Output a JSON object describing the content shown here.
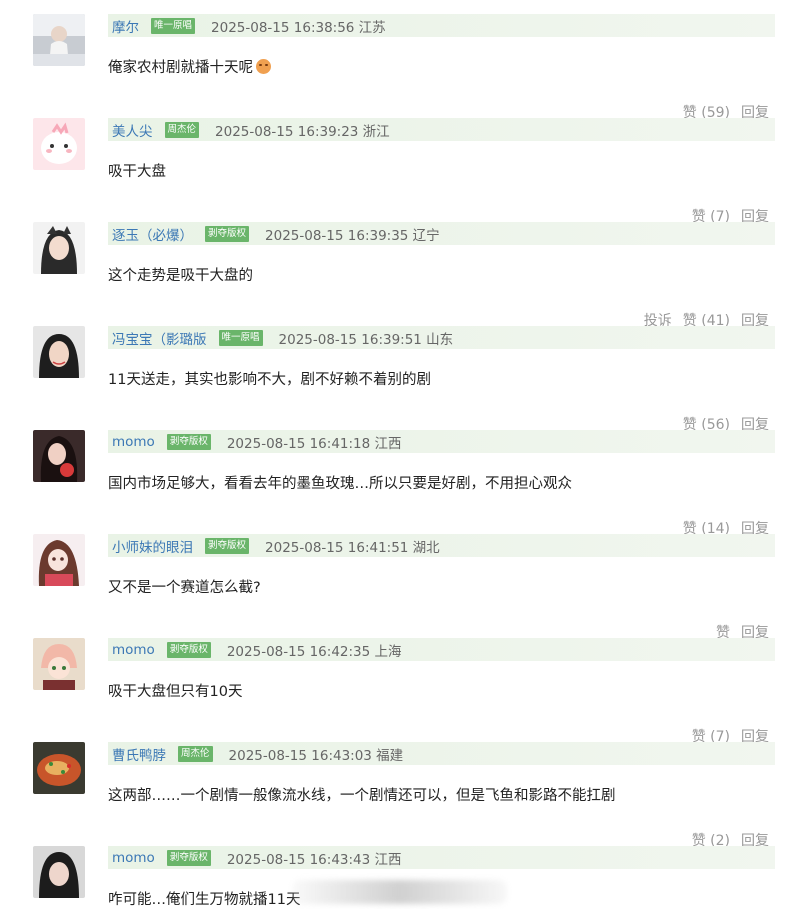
{
  "comments": [
    {
      "user": "摩尔",
      "badge": "唯一原唱",
      "time": "2025-08-15 16:38:56 江苏",
      "text": "俺家农村剧就播十天呢",
      "like": "赞 (59)",
      "reply": "回复",
      "report": ""
    },
    {
      "user": "美人尖",
      "badge": "周杰伦",
      "time": "2025-08-15 16:39:23 浙江",
      "text": "吸干大盘",
      "like": "赞 (7)",
      "reply": "回复",
      "report": ""
    },
    {
      "user": "逐玉（必爆）",
      "badge": "剥夺版权",
      "time": "2025-08-15 16:39:35 辽宁",
      "text": "这个走势是吸干大盘的",
      "like": "赞 (41)",
      "reply": "回复",
      "report": "投诉"
    },
    {
      "user": "冯宝宝（影璐版",
      "badge": "唯一原唱",
      "time": "2025-08-15 16:39:51 山东",
      "text": "11天送走，其实也影响不大，剧不好赖不着别的剧",
      "like": "赞 (56)",
      "reply": "回复",
      "report": ""
    },
    {
      "user": "momo",
      "badge": "剥夺版权",
      "time": "2025-08-15 16:41:18 江西",
      "text": "国内市场足够大，看看去年的墨鱼玫瑰…所以只要是好剧，不用担心观众",
      "like": "赞 (14)",
      "reply": "回复",
      "report": ""
    },
    {
      "user": "小师妹的眼泪",
      "badge": "剥夺版权",
      "time": "2025-08-15 16:41:51 湖北",
      "text": "又不是一个赛道怎么截?",
      "like": "赞",
      "reply": "回复",
      "report": ""
    },
    {
      "user": "momo",
      "badge": "剥夺版权",
      "time": "2025-08-15 16:42:35 上海",
      "text": "吸干大盘但只有10天",
      "like": "赞 (7)",
      "reply": "回复",
      "report": ""
    },
    {
      "user": "曹氏鸭脖",
      "badge": "周杰伦",
      "time": "2025-08-15 16:43:03 福建",
      "text": "这两部……一个剧情一般像流水线，一个剧情还可以，但是飞鱼和影路不能扛剧",
      "like": "赞 (2)",
      "reply": "回复",
      "report": ""
    },
    {
      "user": "momo",
      "badge": "剥夺版权",
      "time": "2025-08-15 16:43:43 江西",
      "text": "咋可能…俺们生万物就播11天",
      "like": "",
      "reply": "",
      "report": ""
    }
  ],
  "colors": {
    "username": "#3c78b5",
    "badge": "#6ab56a",
    "meta_bar": "#ecf4e9",
    "action_text": "#999999"
  }
}
